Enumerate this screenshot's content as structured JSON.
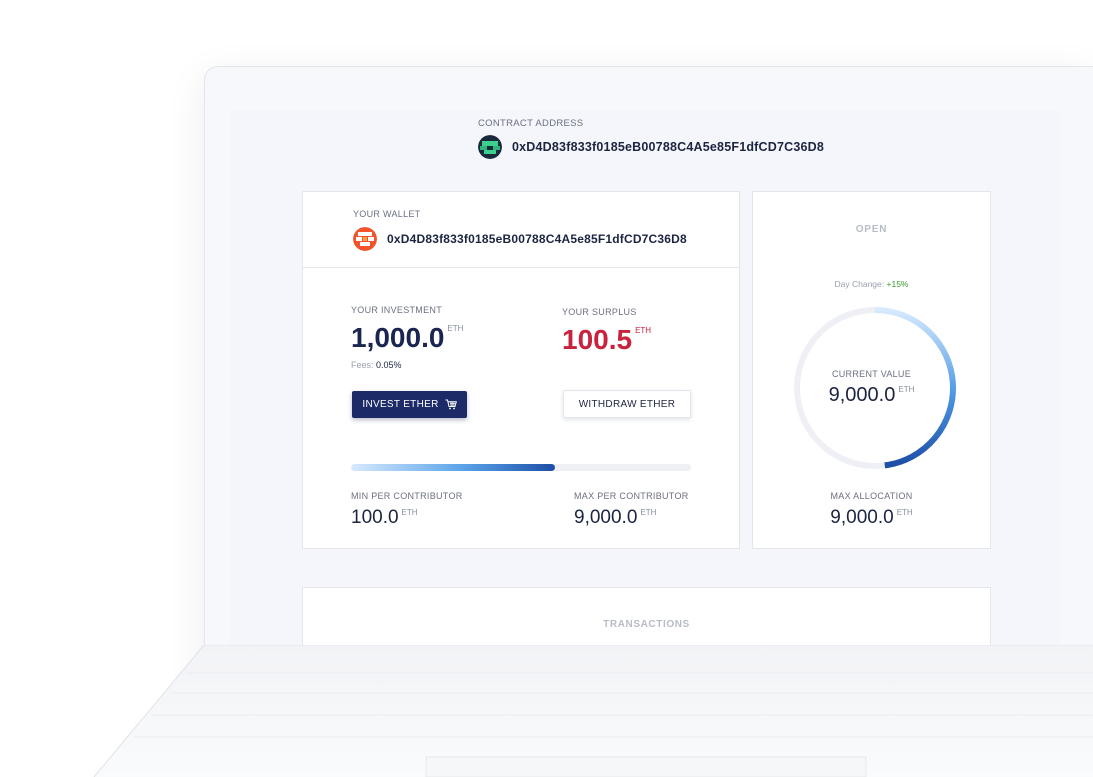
{
  "contract": {
    "label": "CONTRACT ADDRESS",
    "address": "0xD4D83f833f0185eB00788C4A5e85F1dfCD7C36D8"
  },
  "wallet": {
    "label": "YOUR WALLET",
    "address": "0xD4D83f833f0185eB00788C4A5e85F1dfCD7C36D8"
  },
  "investment": {
    "label": "YOUR INVESTMENT",
    "value": "1,000.0",
    "unit": "ETH",
    "fees_label": "Fees:",
    "fees_value": "0.05%"
  },
  "surplus": {
    "label": "YOUR SURPLUS",
    "value": "100.5",
    "unit": "ETH"
  },
  "buttons": {
    "invest": "INVEST ETHER",
    "withdraw": "WITHDRAW ETHER"
  },
  "progress": {
    "fraction": 0.6
  },
  "min_contributor": {
    "label": "MIN PER CONTRIBUTOR",
    "value": "100.0",
    "unit": "ETH"
  },
  "max_contributor": {
    "label": "MAX PER CONTRIBUTOR",
    "value": "9,000.0",
    "unit": "ETH"
  },
  "status": {
    "label": "OPEN",
    "day_change_label": "Day Change:",
    "day_change_value": "+15%"
  },
  "gauge": {
    "label": "CURRENT VALUE",
    "value": "9,000.0",
    "unit": "ETH",
    "fraction": 0.48
  },
  "max_allocation": {
    "label": "MAX ALLOCATION",
    "value": "9,000.0",
    "unit": "ETH"
  },
  "transactions": {
    "title": "TRANSACTIONS"
  },
  "colors": {
    "navy": "#1c2a68",
    "red": "#c8223c",
    "green": "#3a9a2c",
    "accent_blue": "#1d4ea8"
  },
  "icons": [
    "identicon-avatar",
    "cart-icon"
  ]
}
